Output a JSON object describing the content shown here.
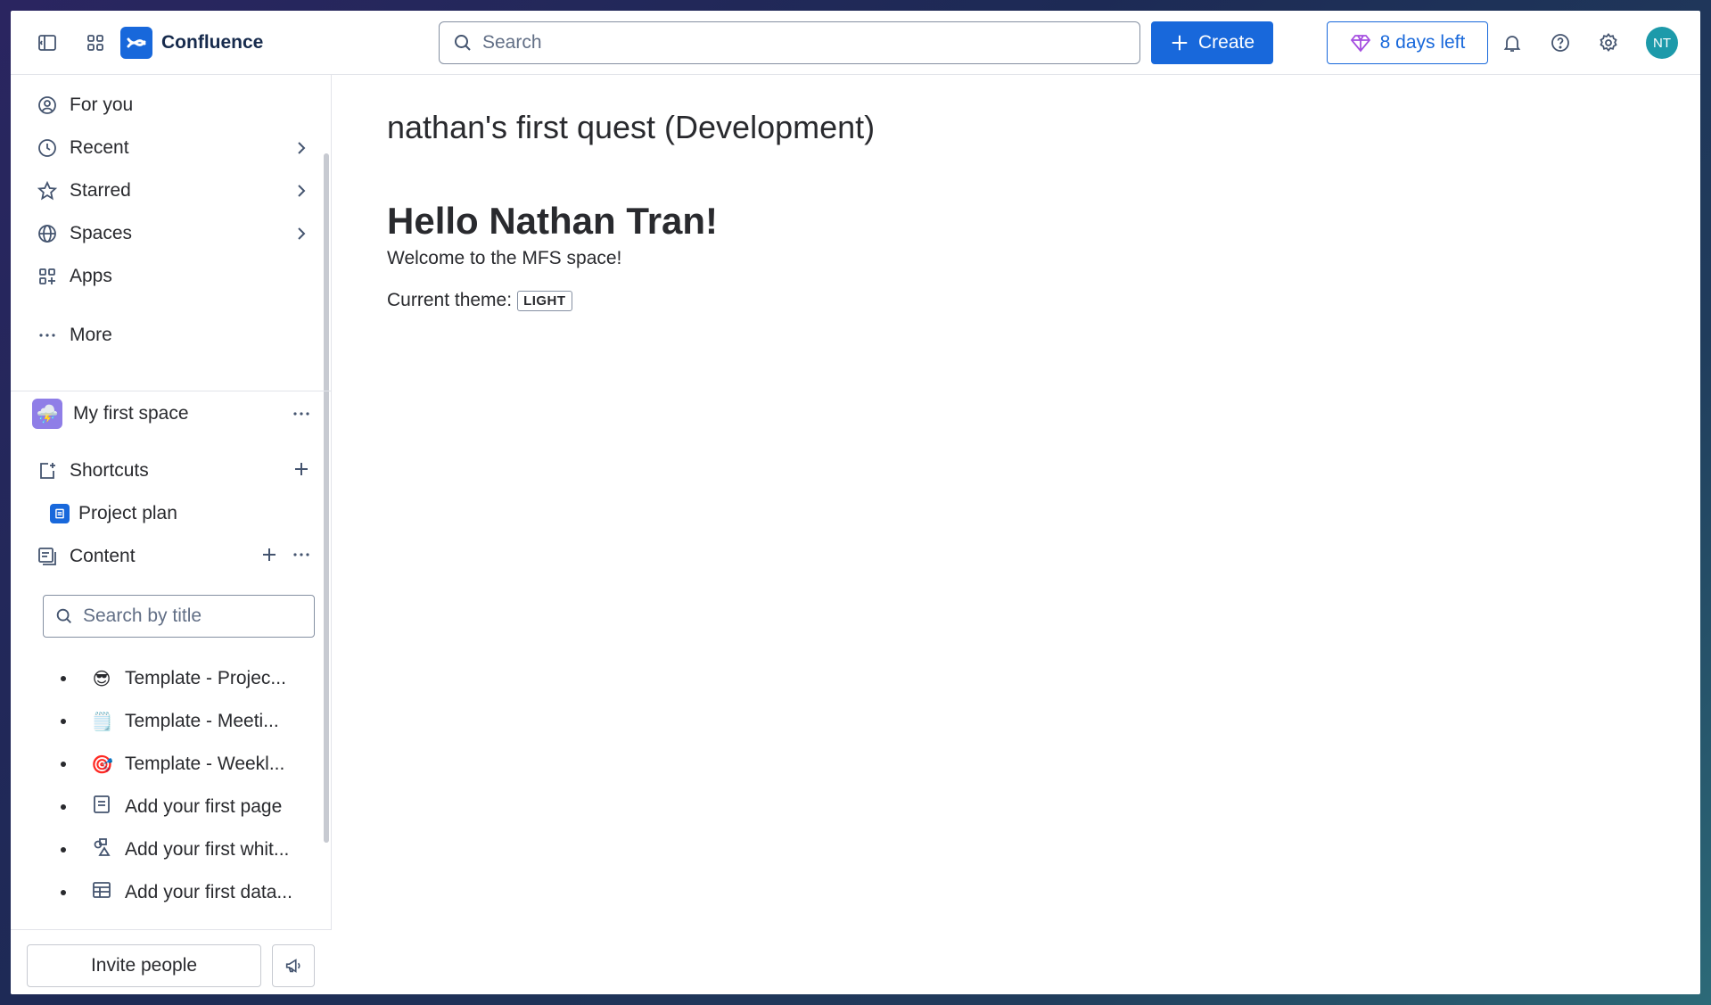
{
  "app": {
    "name": "Confluence"
  },
  "topbar": {
    "search_placeholder": "Search",
    "create_label": "Create",
    "trial_label": "8 days left",
    "avatar_initials": "NT"
  },
  "sidebar": {
    "nav": [
      {
        "label": "For you",
        "icon": "user-circle-icon"
      },
      {
        "label": "Recent",
        "icon": "clock-icon"
      },
      {
        "label": "Starred",
        "icon": "star-icon"
      },
      {
        "label": "Spaces",
        "icon": "globe-icon"
      },
      {
        "label": "Apps",
        "icon": "apps-icon"
      },
      {
        "label": "More",
        "icon": "more-icon"
      }
    ],
    "space": {
      "name": "My first space",
      "icon": "⛈️"
    },
    "shortcuts_label": "Shortcuts",
    "shortcuts": [
      {
        "label": "Project plan"
      }
    ],
    "content_label": "Content",
    "title_search_placeholder": "Search by title",
    "tree": [
      {
        "emoji": "😎",
        "label": "Template - Projec..."
      },
      {
        "emoji": "🗒️",
        "label": "Template - Meeti..."
      },
      {
        "emoji": "🎯",
        "label": "Template - Weekl..."
      },
      {
        "emoji": "",
        "label": "Add your first page"
      },
      {
        "emoji": "",
        "label": "Add your first whit..."
      },
      {
        "emoji": "",
        "label": "Add your first data..."
      }
    ],
    "invite_label": "Invite people"
  },
  "main": {
    "page_title": "nathan's first quest (Development)",
    "heading": "Hello Nathan Tran!",
    "welcome": "Welcome to the MFS space!",
    "theme_label": "Current theme:",
    "theme_value": "LIGHT"
  },
  "colors": {
    "accent": "#1868db",
    "text": "#292a2e",
    "avatar": "#1d9aaa",
    "space_icon": "#8f7ee7"
  }
}
